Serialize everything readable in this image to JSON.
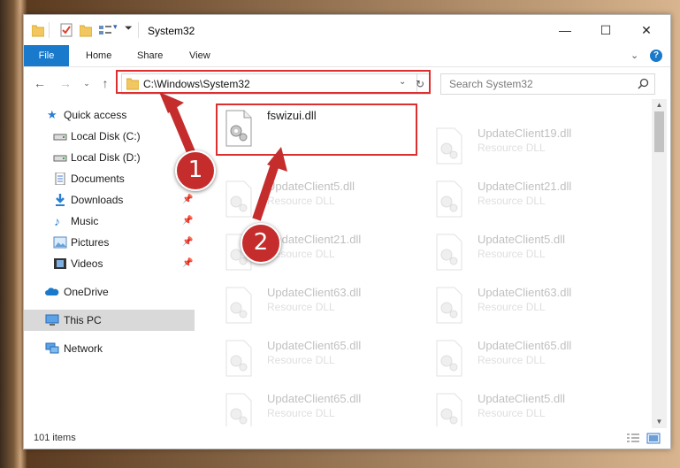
{
  "window": {
    "title": "System32"
  },
  "ribbon": {
    "tabs": [
      "File",
      "Home",
      "Share",
      "View"
    ]
  },
  "nav": {
    "address": "C:\\Windows\\System32",
    "search_placeholder": "Search System32"
  },
  "sidebar": {
    "items": [
      {
        "label": "Quick access",
        "icon": "star-icon",
        "pinned": false
      },
      {
        "label": "Local Disk (C:)",
        "icon": "drive-icon",
        "pinned": false
      },
      {
        "label": "Local Disk (D:)",
        "icon": "drive-icon",
        "pinned": false
      },
      {
        "label": "Documents",
        "icon": "documents-icon",
        "pinned": false
      },
      {
        "label": "Downloads",
        "icon": "downloads-icon",
        "pinned": true
      },
      {
        "label": "Music",
        "icon": "music-icon",
        "pinned": true
      },
      {
        "label": "Pictures",
        "icon": "pictures-icon",
        "pinned": true
      },
      {
        "label": "Videos",
        "icon": "videos-icon",
        "pinned": true
      },
      {
        "label": "OneDrive",
        "icon": "onedrive-icon",
        "pinned": false
      },
      {
        "label": "This PC",
        "icon": "this-pc-icon",
        "pinned": false,
        "selected": true
      },
      {
        "label": "Network",
        "icon": "network-icon",
        "pinned": false
      }
    ]
  },
  "files": [
    {
      "name": "fswizui.dll",
      "desc": "",
      "highlighted": true
    },
    {
      "name": "UpdateClient19.dll",
      "desc": "Resource DLL",
      "highlighted": false
    },
    {
      "name": "UpdateClient5.dll",
      "desc": "Resource DLL",
      "highlighted": false
    },
    {
      "name": "UpdateClient21.dll",
      "desc": "Resource DLL",
      "highlighted": false
    },
    {
      "name": "UpdateClient21.dll",
      "desc": "Resource DLL",
      "highlighted": false
    },
    {
      "name": "UpdateClient5.dll",
      "desc": "Resource DLL",
      "highlighted": false
    },
    {
      "name": "UpdateClient63.dll",
      "desc": "Resource DLL",
      "highlighted": false
    },
    {
      "name": "UpdateClient63.dll",
      "desc": "Resource DLL",
      "highlighted": false
    },
    {
      "name": "UpdateClient65.dll",
      "desc": "Resource DLL",
      "highlighted": false
    },
    {
      "name": "UpdateClient65.dll",
      "desc": "Resource DLL",
      "highlighted": false
    },
    {
      "name": "UpdateClient65.dll",
      "desc": "Resource DLL",
      "highlighted": false
    },
    {
      "name": "UpdateClient5.dll",
      "desc": "Resource DLL",
      "highlighted": false
    }
  ],
  "status": {
    "item_count": "101 items"
  },
  "annotations": {
    "step1": "1",
    "step2": "2",
    "color": "#dd2f2f"
  },
  "colors": {
    "accent": "#1979ca",
    "selection": "#d9d9d9"
  }
}
